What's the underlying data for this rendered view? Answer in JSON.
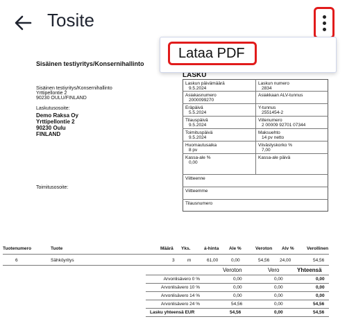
{
  "appbar": {
    "title": "Tosite"
  },
  "menu": {
    "download_pdf": "Lataa PDF"
  },
  "invoice": {
    "company": "Sisäinen testiyritys/Konsernihallinto",
    "heading": "LASKU",
    "sender": [
      "Sisäinen testiyritys/Konsernihallinto",
      "Yrttipellontie 2",
      "90230 OULU/FINLAND"
    ],
    "billing_label": "Laskutusosoite:",
    "billing": [
      "Demo Raksa Oy",
      "Yrttipellontie 2",
      "90230 Oulu",
      "FINLAND"
    ],
    "delivery_label": "Toimitusosoite:",
    "fields": {
      "invoice_date_label": "Laskun päivämäärä",
      "invoice_date": "9.5.2024",
      "invoice_no_label": "Laskun numero",
      "invoice_no": "2834",
      "customer_no_label": "Asiakasnumero",
      "customer_no": "2000099270",
      "vat_id_label": "Asiakkaan ALV-tunnus",
      "due_label": "Eräpäivä",
      "due": "5.5.2024",
      "business_id_label": "Y-tunnus",
      "business_id": "2551454-2",
      "order_date_label": "Tilauspäivä",
      "order_date": "9.5.2024",
      "reference_label": "Viitenumero",
      "reference": "2 00009 92701 07344",
      "delivery_date_label": "Toimituspäivä",
      "delivery_date": "9.5.2024",
      "payment_terms_label": "Maksuehto",
      "payment_terms": "14 pv netto",
      "notice_label": "Huomautusaika",
      "notice": "8 pv",
      "interest_label": "Viivästyskorko %",
      "interest": "7,00",
      "cash_discount_label": "Kassa-ale %",
      "cash_discount": "0,00",
      "cash_discount_date_label": "Kassa-ale päivä",
      "your_ref_label": "Viitteenne",
      "our_ref_label": "Viitteemme",
      "order_no_label": "Tilausnumero"
    },
    "columns": [
      "Tuotenumero",
      "Tuote",
      "Määrä",
      "Yks.",
      "á-hinta",
      "Ale %",
      "Veroton",
      "Alv %",
      "Verollinen"
    ],
    "rows": [
      [
        "6",
        "Sähköyritys",
        "3",
        "m",
        "61,00",
        "0,00",
        "54,56",
        "24,00",
        "54,56"
      ]
    ],
    "totals_header": [
      "Veroton",
      "Vero",
      "Yhteensä"
    ],
    "totals": [
      [
        "Arvonlisävero 0 %",
        "0,00",
        "0,00",
        "0,00"
      ],
      [
        "Arvonlisävero 10 %",
        "0,00",
        "0,00",
        "0,00"
      ],
      [
        "Arvonlisävero 14 %",
        "0,00",
        "0,00",
        "0,00"
      ],
      [
        "Arvonlisävero 24 %",
        "54,56",
        "0,00",
        "54,56"
      ],
      [
        "Lasku yhteensä EUR",
        "54,56",
        "0,00",
        "54,56"
      ]
    ]
  }
}
